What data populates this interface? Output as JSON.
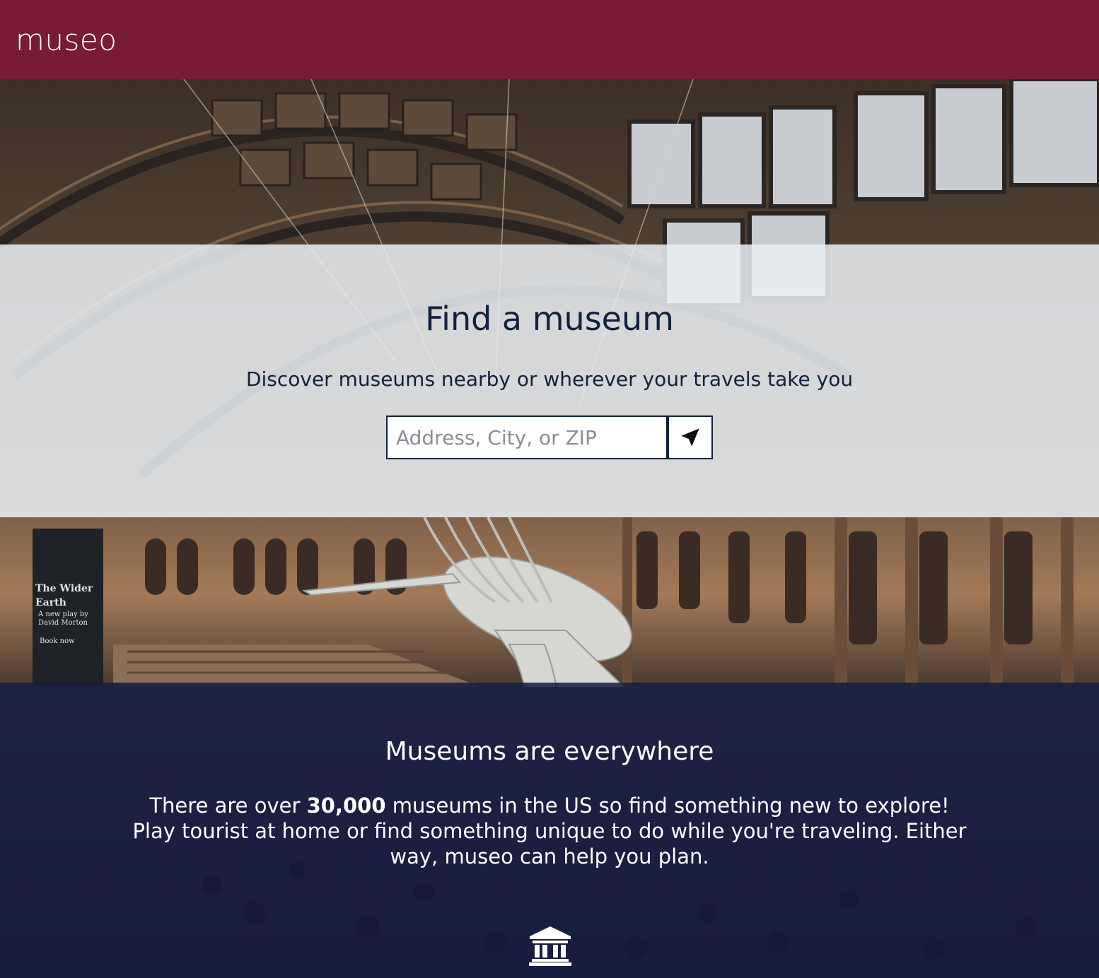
{
  "header": {
    "logo_text": "museo",
    "background_color": "#781b35"
  },
  "find": {
    "title": "Find a museum",
    "subtitle": "Discover museums nearby or wherever your travels take you",
    "search": {
      "placeholder": "Address, City, or ZIP",
      "value": ""
    },
    "locate_icon": "location-arrow-icon"
  },
  "info": {
    "title": "Museums are everywhere",
    "text_before": "There are over ",
    "highlight": "30,000",
    "text_after": " museums in the US so find something new to explore! Play tourist at home or find something unique to do while you're traveling. Either way, museo can help you plan.",
    "footer_icon": "museum-building-icon",
    "background_color": "#141b42"
  },
  "background_image": {
    "sign_lines": [
      "The Wider",
      "Earth",
      "A new play by",
      "David Morton",
      "Book now"
    ]
  }
}
